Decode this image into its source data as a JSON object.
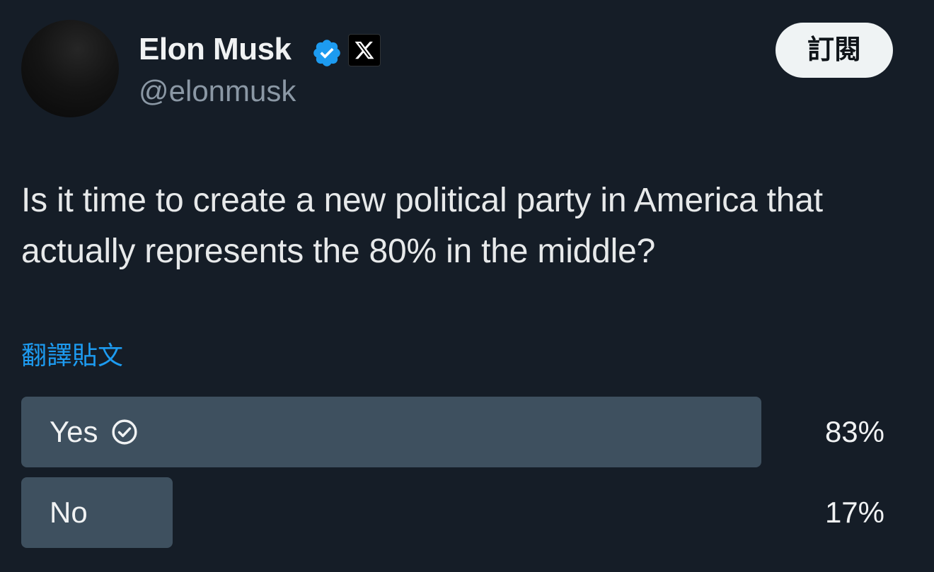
{
  "author": {
    "display_name": "Elon Musk",
    "handle": "@elonmusk",
    "verified_icon": "verified-badge-icon",
    "affiliate_icon": "x-logo-icon"
  },
  "subscribe_label": "訂閱",
  "post": {
    "text": "Is it time to create a new political party in America that actually represents the 80% in the middle?"
  },
  "translate_label": "翻譯貼文",
  "poll": {
    "options": [
      {
        "label": "Yes",
        "percent_label": "83%",
        "percent": 83,
        "selected": true
      },
      {
        "label": "No",
        "percent_label": "17%",
        "percent": 17,
        "selected": false
      }
    ]
  },
  "colors": {
    "background": "#151d27",
    "accent_blue": "#1d9bf0",
    "poll_bar": "#3e505f"
  }
}
